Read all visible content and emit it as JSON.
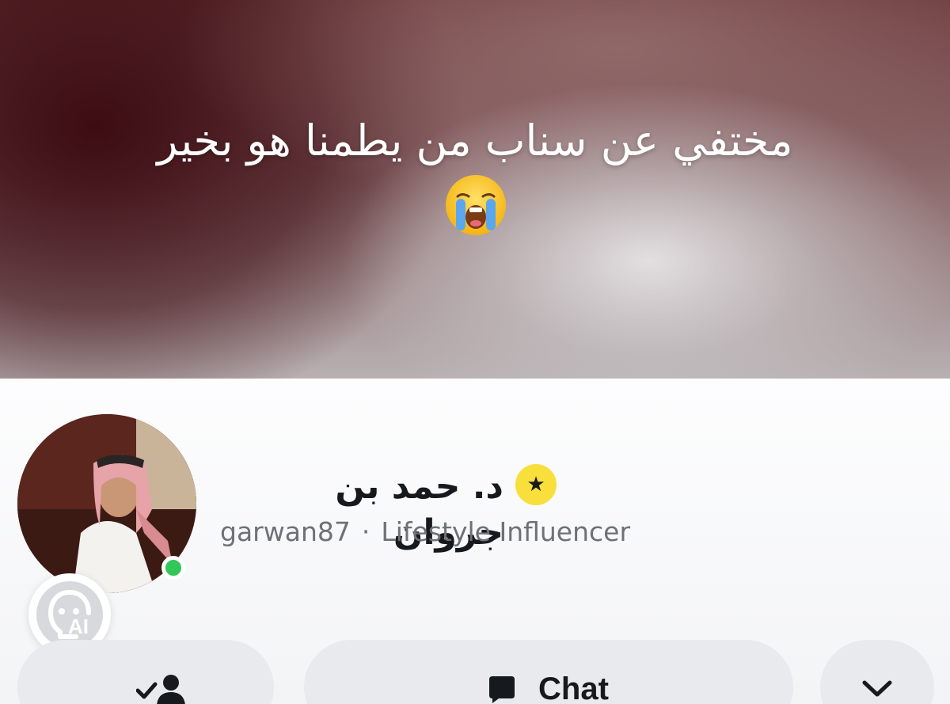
{
  "story": {
    "caption": "مختفي عن سناب من يطمنا هو بخير",
    "caption_emoji": "loudly-crying-face-icon"
  },
  "profile": {
    "display_name": "د. حمد بن جروان",
    "username": "garwan87",
    "separator": "·",
    "category": "Lifestyle Influencer",
    "online": true,
    "badge_icon": "star-icon",
    "ai_badge_text": "AI"
  },
  "actions": {
    "add_friend_icon": "added-friend-icon",
    "chat_label": "Chat",
    "more_icon": "chevron-down-icon"
  },
  "colors": {
    "star_badge": "#f8df3c",
    "online": "#33c759",
    "button_bg": "#e9eaed"
  }
}
